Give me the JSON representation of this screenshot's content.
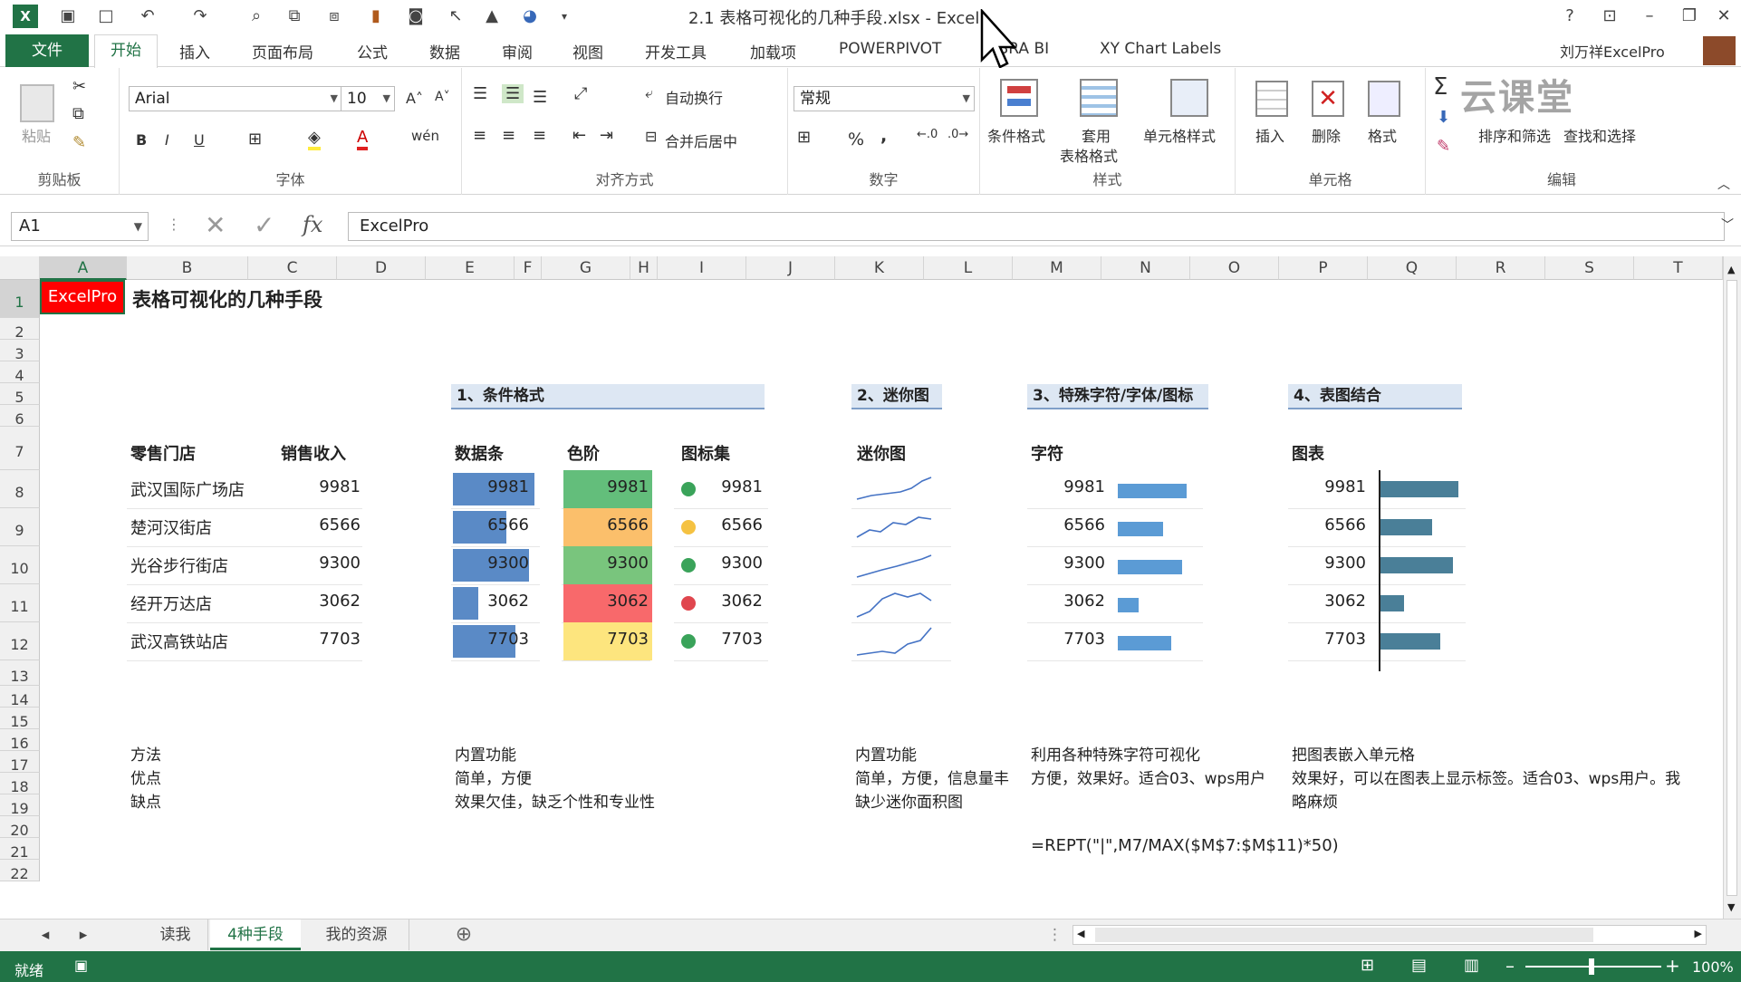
{
  "window": {
    "title": "2.1 表格可视化的几种手段.xlsx - Excel",
    "help": "?",
    "restore_ribbon": "⊡",
    "minimize": "–",
    "restore": "❐",
    "close": "✕"
  },
  "tabs": [
    {
      "label": "文件"
    },
    {
      "label": "开始"
    },
    {
      "label": "插入"
    },
    {
      "label": "页面布局"
    },
    {
      "label": "公式"
    },
    {
      "label": "数据"
    },
    {
      "label": "审阅"
    },
    {
      "label": "视图"
    },
    {
      "label": "开发工具"
    },
    {
      "label": "加载项"
    },
    {
      "label": "POWERPIVOT"
    },
    {
      "label": "ABRA BI"
    },
    {
      "label": "XY Chart Labels"
    }
  ],
  "user": "刘万祥ExcelPro",
  "ribbon": {
    "clipboard": {
      "paste": "粘贴",
      "label": "剪贴板"
    },
    "font": {
      "name": "Arial",
      "size": "10",
      "bold": "B",
      "italic": "I",
      "underline": "U",
      "label": "字体"
    },
    "align": {
      "wrap": "自动换行",
      "merge": "合并后居中",
      "label": "对齐方式"
    },
    "number": {
      "format": "常规",
      "percent": "%",
      "comma": ",",
      "label": "数字"
    },
    "styles": {
      "cond": "条件格式",
      "table1": "套用",
      "table2": "表格格式",
      "cell": "单元格样式",
      "label": "样式"
    },
    "cells": {
      "insert": "插入",
      "delete": "删除",
      "format": "格式",
      "label": "单元格"
    },
    "edit": {
      "sort": "排序和筛选",
      "find": "查找和选择",
      "label": "编辑"
    }
  },
  "watermark": "云课堂",
  "formula_bar": {
    "namebox": "A1",
    "fx": "fx",
    "value": "ExcelPro"
  },
  "columns": [
    "A",
    "B",
    "C",
    "D",
    "E",
    "F",
    "G",
    "H",
    "I",
    "J",
    "K",
    "L",
    "M",
    "N",
    "O",
    "P",
    "Q",
    "R",
    "S",
    "T"
  ],
  "rows": [
    "1",
    "2",
    "3",
    "4",
    "5",
    "6",
    "7",
    "8",
    "9",
    "10",
    "11",
    "12",
    "13",
    "14",
    "15",
    "16",
    "17",
    "18",
    "19",
    "20",
    "21",
    "22"
  ],
  "sheet": {
    "a1": "ExcelPro",
    "title": "表格可视化的几种手段",
    "sections": [
      "1、条件格式",
      "2、迷你图",
      "3、特殊字符/字体/图标",
      "4、表图结合"
    ],
    "headers": {
      "store": "零售门店",
      "sales": "销售收入",
      "databar": "数据条",
      "colorscale": "色阶",
      "iconset": "图标集",
      "sparkline": "迷你图",
      "char": "字符",
      "chart": "图表"
    },
    "stores": [
      "武汉国际广场店",
      "楚河汉街店",
      "光谷步行街店",
      "经开万达店",
      "武汉高铁站店"
    ],
    "values": [
      "9981",
      "6566",
      "9300",
      "3062",
      "7703"
    ],
    "value_fractions": [
      1.0,
      0.658,
      0.932,
      0.307,
      0.772
    ],
    "colorscale_colors": [
      "#63be7b",
      "#fbbf6b",
      "#79c57d",
      "#f8696b",
      "#fde57e"
    ],
    "icon_colors": [
      "#3aa35a",
      "#f5c242",
      "#3aa35a",
      "#e0464e",
      "#3aa35a"
    ],
    "notes": {
      "method": "方法",
      "pro": "优点",
      "con": "缺点",
      "m1": "内置功能",
      "p1": "简单，方便",
      "c1": "效果欠佳，缺乏个性和专业性",
      "m2": "内置功能",
      "p2": "简单，方便，信息量丰",
      "c2": "缺少迷你面积图",
      "m3": "利用各种特殊字符可视化",
      "p3": "方便，效果好。适合03、wps用户",
      "m4": "把图表嵌入单元格",
      "p4": "效果好，可以在图表上显示标签。适合03、wps用户。我",
      "c4": "略麻烦",
      "formula": "=REPT(\"|\",M7/MAX($M$7:$M$11)*50)"
    }
  },
  "sheets": [
    "读我",
    "4种手段",
    "我的资源"
  ],
  "status": {
    "ready": "就绪",
    "zoom": "100%"
  }
}
